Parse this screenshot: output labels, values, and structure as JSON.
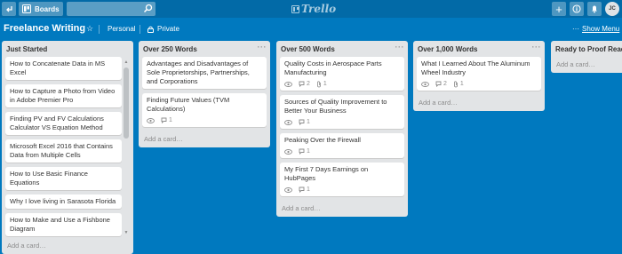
{
  "header": {
    "boards_label": "Boards",
    "search_value": "",
    "logo_text": "Trello",
    "avatar_initials": "JC"
  },
  "board": {
    "title": "Freelance Writing",
    "visibility_team": "Personal",
    "visibility_privacy": "Private",
    "show_menu_label": "Show Menu"
  },
  "lists": [
    {
      "title": "Just Started",
      "cards": [
        {
          "title": "How to Concatenate Data in MS Excel"
        },
        {
          "title": "How to Capture a Photo from Video in Adobe Premier Pro"
        },
        {
          "title": "Finding PV and FV Calculations Calculator VS Equation Method"
        },
        {
          "title": "Microsoft Excel 2016 that Contains Data from Multiple Cells"
        },
        {
          "title": "How to Use Basic Finance Equations"
        },
        {
          "title": "Why I love living in Sarasota Florida"
        },
        {
          "title": "How to Make and Use a Fishbone Diagram"
        }
      ],
      "add_card": "Add a card…"
    },
    {
      "title": "Over 250 Words",
      "cards": [
        {
          "title": "Advantages and Disadvantages of Sole Proprietorships, Partnerships, and Corporations"
        },
        {
          "title": "Finding Future Values (TVM Calculations)",
          "comments": "1"
        }
      ],
      "add_card": "Add a card…"
    },
    {
      "title": "Over 500 Words",
      "cards": [
        {
          "title": "Quality Costs in Aerospace Parts Manufacturing",
          "comments": "2",
          "attachments": "1"
        },
        {
          "title": "Sources of Quality Improvement to Better Your Business",
          "comments": "1"
        },
        {
          "title": "Peaking Over the Firewall",
          "comments": "1"
        },
        {
          "title": "My First 7 Days Earnings on HubPages",
          "comments": "1"
        }
      ],
      "add_card": "Add a card…"
    },
    {
      "title": "Over 1,000 Words",
      "cards": [
        {
          "title": "What I Learned About The Aluminum Wheel Industry",
          "comments": "2",
          "attachments": "1"
        }
      ],
      "add_card": "Add a card…"
    },
    {
      "title": "Ready to Proof Read",
      "cards": [],
      "add_card": "Add a card…"
    }
  ],
  "icons": {
    "back": "back-arrow-icon",
    "boards": "board-icon",
    "search": "search-icon",
    "add": "plus-icon",
    "info": "info-icon",
    "notifications": "bell-icon",
    "star": "star-icon",
    "lock": "lock-icon",
    "menu": "more-icon",
    "watch": "eye-icon",
    "comment": "comment-icon",
    "attachment": "paperclip-icon"
  },
  "colors": {
    "board_bg": "#0079bf",
    "header_bg": "#026aa7",
    "list_bg": "#e2e4e6",
    "card_bg": "#ffffff"
  }
}
